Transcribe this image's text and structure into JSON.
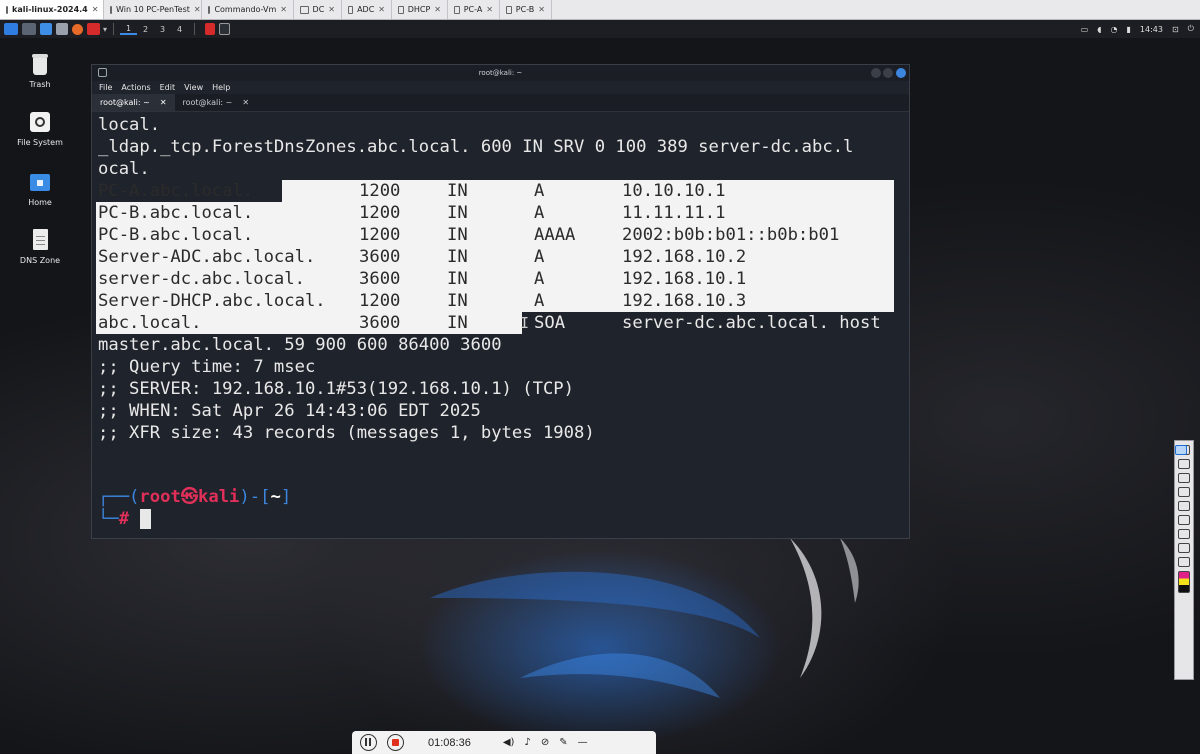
{
  "vm_tabs": [
    {
      "label": "kali-linux-2024.4",
      "active": true
    },
    {
      "label": "Win 10 PC-PenTest",
      "active": false
    },
    {
      "label": "Commando-Vm",
      "active": false
    },
    {
      "label": "DC",
      "active": false
    },
    {
      "label": "ADC",
      "active": false
    },
    {
      "label": "DHCP",
      "active": false
    },
    {
      "label": "PC-A",
      "active": false
    },
    {
      "label": "PC-B",
      "active": false
    }
  ],
  "panel": {
    "workspaces": [
      "1",
      "2",
      "3",
      "4"
    ],
    "clock": "14:43"
  },
  "desktop_icons": [
    {
      "label": "Trash",
      "icon": "trash-icon"
    },
    {
      "label": "File System",
      "icon": "drive-icon"
    },
    {
      "label": "Home",
      "icon": "home-folder-icon"
    },
    {
      "label": "DNS Zone",
      "icon": "document-icon"
    }
  ],
  "terminal": {
    "title": "root@kali: ~",
    "menu": [
      "File",
      "Actions",
      "Edit",
      "View",
      "Help"
    ],
    "tabs": [
      "root@kali: ~",
      "root@kali: ~"
    ],
    "pre_lines": [
      "local.",
      "_ldap._tcp.ForestDnsZones.abc.local. 600 IN SRV 0 100 389 server-dc.abc.l",
      "ocal."
    ],
    "records": [
      {
        "name": "PC-A.abc.local.",
        "ttl": "1200",
        "class": "IN",
        "type": "A",
        "data": "10.10.10.1"
      },
      {
        "name": "PC-B.abc.local.",
        "ttl": "1200",
        "class": "IN",
        "type": "A",
        "data": "11.11.11.1"
      },
      {
        "name": "PC-B.abc.local.",
        "ttl": "1200",
        "class": "IN",
        "type": "AAAA",
        "data": "2002:b0b:b01::b0b:b01"
      },
      {
        "name": "Server-ADC.abc.local.",
        "ttl": "3600",
        "class": "IN",
        "type": "A",
        "data": "192.168.10.2"
      },
      {
        "name": "server-dc.abc.local.",
        "ttl": "3600",
        "class": "IN",
        "type": "A",
        "data": "192.168.10.1"
      },
      {
        "name": "Server-DHCP.abc.local.",
        "ttl": "1200",
        "class": "IN",
        "type": "A",
        "data": "192.168.10.3"
      },
      {
        "name": "abc.local.",
        "ttl": "3600",
        "class": "IN",
        "type": "SOA",
        "data": "server-dc.abc.local. host"
      }
    ],
    "post_lines": [
      "master.abc.local. 59 900 600 86400 3600",
      ";; Query time: 7 msec",
      ";; SERVER: 192.168.10.1#53(192.168.10.1) (TCP)",
      ";; WHEN: Sat Apr 26 14:43:06 EDT 2025",
      ";; XFR size: 43 records (messages 1, bytes 1908)"
    ],
    "prompt": {
      "open": "┌──(",
      "user": "root",
      "at": "㉿",
      "host": "kali",
      "mid": ")-[",
      "dir": "~",
      "close": "]",
      "second": "└─",
      "hash": "#"
    }
  },
  "recorder": {
    "time": "01:08:36"
  },
  "colors": {
    "prompt_red": "#e0305a",
    "prompt_blue": "#3d86e0",
    "selection": "#f3f3f3",
    "terminal_bg": "#1f232b"
  }
}
